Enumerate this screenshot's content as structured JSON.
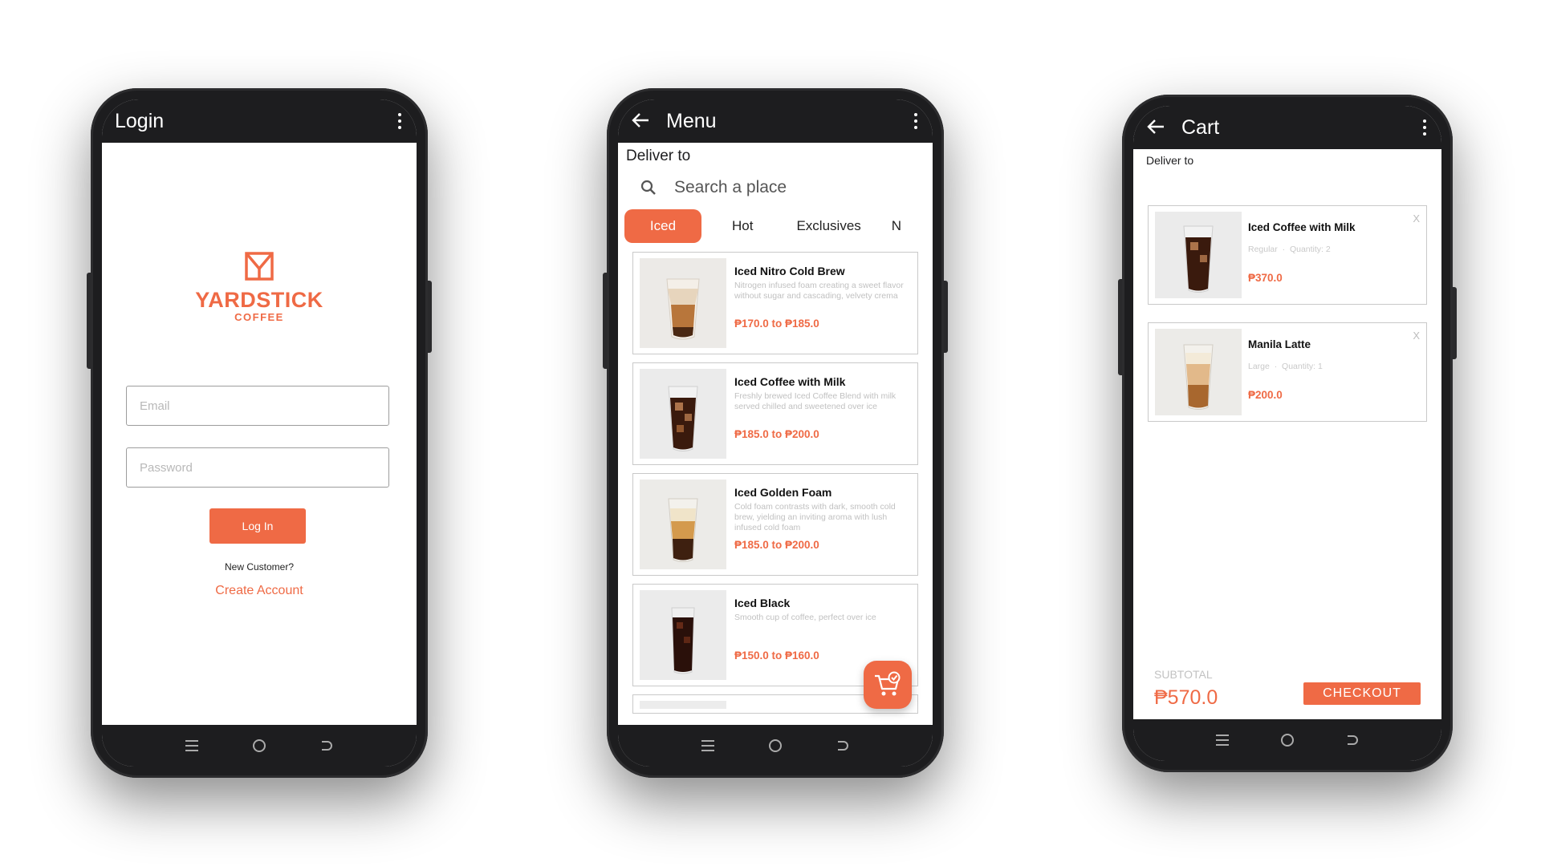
{
  "colors": {
    "accent": "#ef6a45",
    "frame": "#1d1d1f"
  },
  "login": {
    "appbar_title": "Login",
    "logo_text": "YARDSTICK",
    "logo_sub": "COFFEE",
    "email_placeholder": "Email",
    "password_placeholder": "Password",
    "login_button": "Log In",
    "new_customer": "New Customer?",
    "create_account": "Create Account"
  },
  "menu": {
    "appbar_title": "Menu",
    "deliver_label": "Deliver to",
    "search_placeholder": "Search a place",
    "tabs": [
      {
        "label": "Iced",
        "active": true
      },
      {
        "label": "Hot",
        "active": false
      },
      {
        "label": "Exclusives",
        "active": false
      },
      {
        "label": "N",
        "active": false
      }
    ],
    "products": [
      {
        "name": "Iced Nitro Cold Brew",
        "description": "Nitrogen infused foam creating a sweet flavor without sugar and cascading, velvety crema",
        "price": "₱170.0 to ₱185.0"
      },
      {
        "name": "Iced Coffee with Milk",
        "description": "Freshly brewed Iced Coffee Blend with milk served chilled and sweetened over ice",
        "price": "₱185.0 to ₱200.0"
      },
      {
        "name": "Iced Golden Foam",
        "description": "Cold foam contrasts with dark, smooth cold brew, yielding an inviting aroma with lush infused cold foam",
        "price": "₱185.0 to ₱200.0"
      },
      {
        "name": "Iced Black",
        "description": "Smooth cup of coffee, perfect over ice",
        "price": "₱150.0 to ₱160.0"
      }
    ]
  },
  "cart": {
    "appbar_title": "Cart",
    "deliver_label": "Deliver to",
    "items": [
      {
        "name": "Iced Coffee with Milk",
        "size": "Regular",
        "quantity": "Quantity: 2",
        "price": "₱370.0",
        "remove": "X"
      },
      {
        "name": "Manila Latte",
        "size": "Large",
        "quantity": "Quantity: 1",
        "price": "₱200.0",
        "remove": "X"
      }
    ],
    "subtotal_label": "SUBTOTAL",
    "subtotal_value": "₱570.0",
    "checkout_button": "CHECKOUT"
  },
  "icons": {
    "back": "arrow-left-icon",
    "overflow": "kebab-menu-icon",
    "search": "search-icon",
    "cart_fab": "cart-check-icon",
    "nav": [
      "recents-icon",
      "home-icon",
      "back-nav-icon"
    ]
  }
}
